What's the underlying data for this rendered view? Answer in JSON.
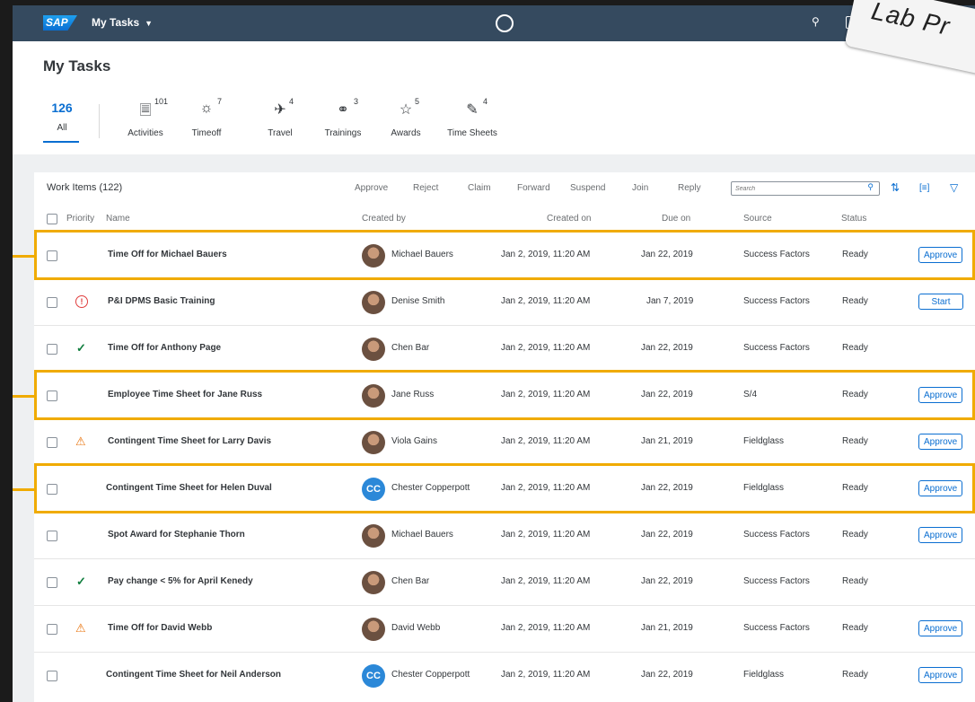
{
  "shell": {
    "logo": "SAP",
    "title": "My Tasks"
  },
  "badge": "Lab Pr",
  "page_title": "My Tasks",
  "tabs": [
    {
      "count": "126",
      "label": "All",
      "icon": "inbox-icon"
    },
    {
      "count": "101",
      "label": "Activities",
      "icon": "document-icon"
    },
    {
      "count": "7",
      "label": "Timeoff",
      "icon": "sun-icon"
    },
    {
      "count": "4",
      "label": "Travel",
      "icon": "airplane-icon"
    },
    {
      "count": "3",
      "label": "Trainings",
      "icon": "group-icon"
    },
    {
      "count": "5",
      "label": "Awards",
      "icon": "trophy-icon"
    },
    {
      "count": "4",
      "label": "Time Sheets",
      "icon": "edit-sheet-icon"
    }
  ],
  "toolbar": {
    "title": "Work Items (122)",
    "actions": [
      "Approve",
      "Reject",
      "Claim",
      "Forward",
      "Suspend",
      "Join",
      "Reply"
    ],
    "search_placeholder": "Search"
  },
  "columns": {
    "priority": "Priority",
    "name": "Name",
    "created_by": "Created by",
    "created_on": "Created on",
    "due_on": "Due on",
    "source": "Source",
    "status": "Status"
  },
  "rows": [
    {
      "priority": "",
      "name": "Time Off for Michael Bauers",
      "created_by": "Michael Bauers",
      "avatar": "photo",
      "created_on": "Jan 2, 2019, 11:20 AM",
      "due_on": "Jan 22, 2019",
      "source": "Success Factors",
      "status": "Ready",
      "action": "Approve"
    },
    {
      "priority": "error",
      "name": "P&I DPMS Basic Training",
      "created_by": "Denise Smith",
      "avatar": "photo",
      "created_on": "Jan 2, 2019, 11:20 AM",
      "due_on": "Jan 7, 2019",
      "source": "Success Factors",
      "status": "Ready",
      "action": "Start"
    },
    {
      "priority": "success",
      "name": "Time Off for Anthony Page",
      "created_by": "Chen Bar",
      "avatar": "photo",
      "created_on": "Jan 2, 2019, 11:20 AM",
      "due_on": "Jan 22, 2019",
      "source": "Success Factors",
      "status": "Ready",
      "action": ""
    },
    {
      "priority": "",
      "name": "Employee Time Sheet for Jane Russ",
      "created_by": "Jane Russ",
      "avatar": "photo",
      "created_on": "Jan 2, 2019, 11:20 AM",
      "due_on": "Jan 22, 2019",
      "source": "S/4",
      "status": "Ready",
      "action": "Approve"
    },
    {
      "priority": "warning",
      "name": "Contingent Time Sheet for Larry Davis",
      "created_by": "Viola Gains",
      "avatar": "photo",
      "created_on": "Jan 2, 2019, 11:20 AM",
      "due_on": "Jan 21, 2019",
      "source": "Fieldglass",
      "status": "Ready",
      "action": "Approve"
    },
    {
      "priority": "",
      "name": "Contingent Time Sheet for Helen Duval",
      "created_by": "Chester Copperpott",
      "avatar": "CC",
      "created_on": "Jan 2, 2019, 11:20 AM",
      "due_on": "Jan 22, 2019",
      "source": "Fieldglass",
      "status": "Ready",
      "action": "Approve"
    },
    {
      "priority": "",
      "name": "Spot Award for Stephanie Thorn",
      "created_by": "Michael Bauers",
      "avatar": "photo",
      "created_on": "Jan 2, 2019, 11:20 AM",
      "due_on": "Jan 22, 2019",
      "source": "Success Factors",
      "status": "Ready",
      "action": "Approve"
    },
    {
      "priority": "success",
      "name": "Pay change < 5% for April Kenedy",
      "created_by": "Chen Bar",
      "avatar": "photo",
      "created_on": "Jan 2, 2019, 11:20 AM",
      "due_on": "Jan 22, 2019",
      "source": "Success Factors",
      "status": "Ready",
      "action": ""
    },
    {
      "priority": "warning",
      "name": "Time Off for David Webb",
      "created_by": "David Webb",
      "avatar": "photo",
      "created_on": "Jan 2, 2019, 11:20 AM",
      "due_on": "Jan 21, 2019",
      "source": "Success Factors",
      "status": "Ready",
      "action": "Approve"
    },
    {
      "priority": "",
      "name": "Contingent Time Sheet for Neil Anderson",
      "created_by": "Chester Copperpott",
      "avatar": "CC",
      "created_on": "Jan 2, 2019, 11:20 AM",
      "due_on": "Jan 22, 2019",
      "source": "Fieldglass",
      "status": "Ready",
      "action": "Approve"
    }
  ],
  "highlighted_rows": [
    0,
    3,
    5
  ],
  "colors": {
    "shell": "#354a5f",
    "accent": "#0a6ed1",
    "highlight": "#f0ab00",
    "error": "#e03e3e",
    "success": "#107e3e",
    "warning": "#e9730c"
  }
}
